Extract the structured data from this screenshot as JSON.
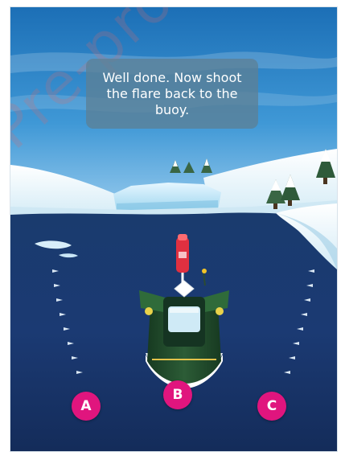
{
  "instruction": {
    "text": "Well done. Now shoot the flare back to the buoy."
  },
  "choices": [
    {
      "label": "A"
    },
    {
      "label": "B"
    },
    {
      "label": "C"
    }
  ],
  "watermark": {
    "text": "Pre-proof"
  },
  "colors": {
    "choice_button": "#e0157e",
    "water": "#1a3a72",
    "boat_hull": "#1f4a2a",
    "flare": "#e03040"
  }
}
